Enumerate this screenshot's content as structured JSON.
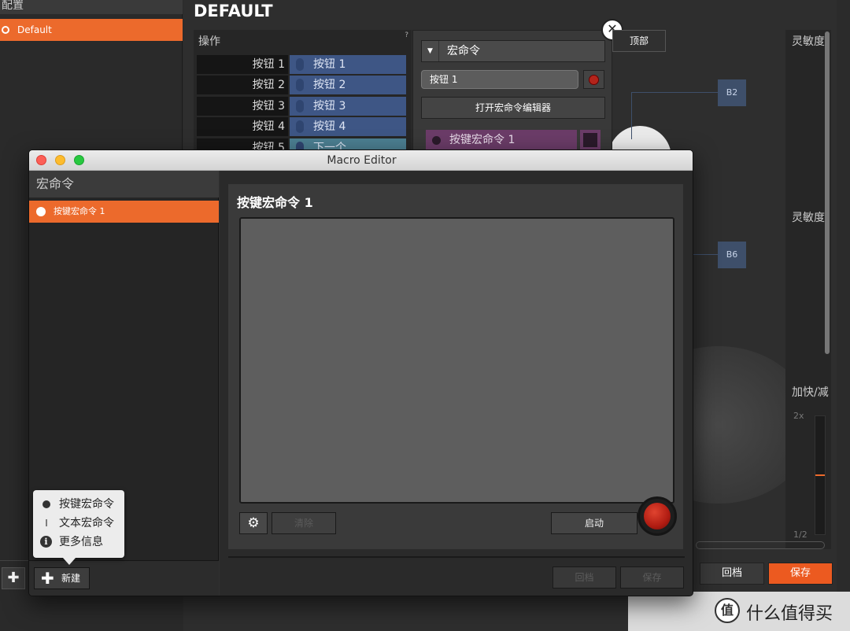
{
  "background": {
    "left_header": "配置",
    "profile_item": "Default",
    "page_title": "DEFAULT",
    "ops_title": "操作",
    "ops_help": "?",
    "ops_rows": [
      {
        "label": "按钮 1",
        "value": "按钮 1"
      },
      {
        "label": "按钮 2",
        "value": "按钮 2"
      },
      {
        "label": "按钮 3",
        "value": "按钮 3"
      },
      {
        "label": "按钮 4",
        "value": "按钮 4"
      },
      {
        "label": "按钮 5",
        "value": "下一个"
      }
    ],
    "popup": {
      "dropdown_value": "宏命令",
      "key_value": "按钮 1",
      "open_editor_label": "打开宏命令编辑器",
      "macro_item": "按键宏命令 1"
    },
    "top_button": "顶部",
    "nodes": [
      "B2",
      "B6"
    ],
    "right_panel": {
      "sensitivity_1": "灵敏度",
      "sensitivity_2": "灵敏度",
      "accel": "加快/减",
      "scale_top": "2x",
      "scale_bottom": "1/2"
    },
    "revert_label": "回档",
    "save_label": "保存",
    "watermark_text": "什么值得买",
    "watermark_logo": "值"
  },
  "window": {
    "title": "Macro Editor",
    "sidebar_header": "宏命令",
    "sidebar_items": [
      "按键宏命令 1"
    ],
    "new_label": "新建",
    "macro_title": "按键宏命令 1",
    "clear_label": "清除",
    "start_label": "启动",
    "revert_label": "回档",
    "save_label": "保存"
  },
  "new_menu": {
    "items": [
      {
        "icon": "record-dot-icon",
        "label": "按键宏命令"
      },
      {
        "icon": "text-cursor-icon",
        "label": "文本宏命令"
      },
      {
        "icon": "info-icon",
        "label": "更多信息"
      }
    ]
  },
  "colors": {
    "accent_orange": "#ec6a2c",
    "record_red": "#b01c12",
    "button_blue": "#3e5685",
    "macro_purple": "#6b3c68"
  }
}
